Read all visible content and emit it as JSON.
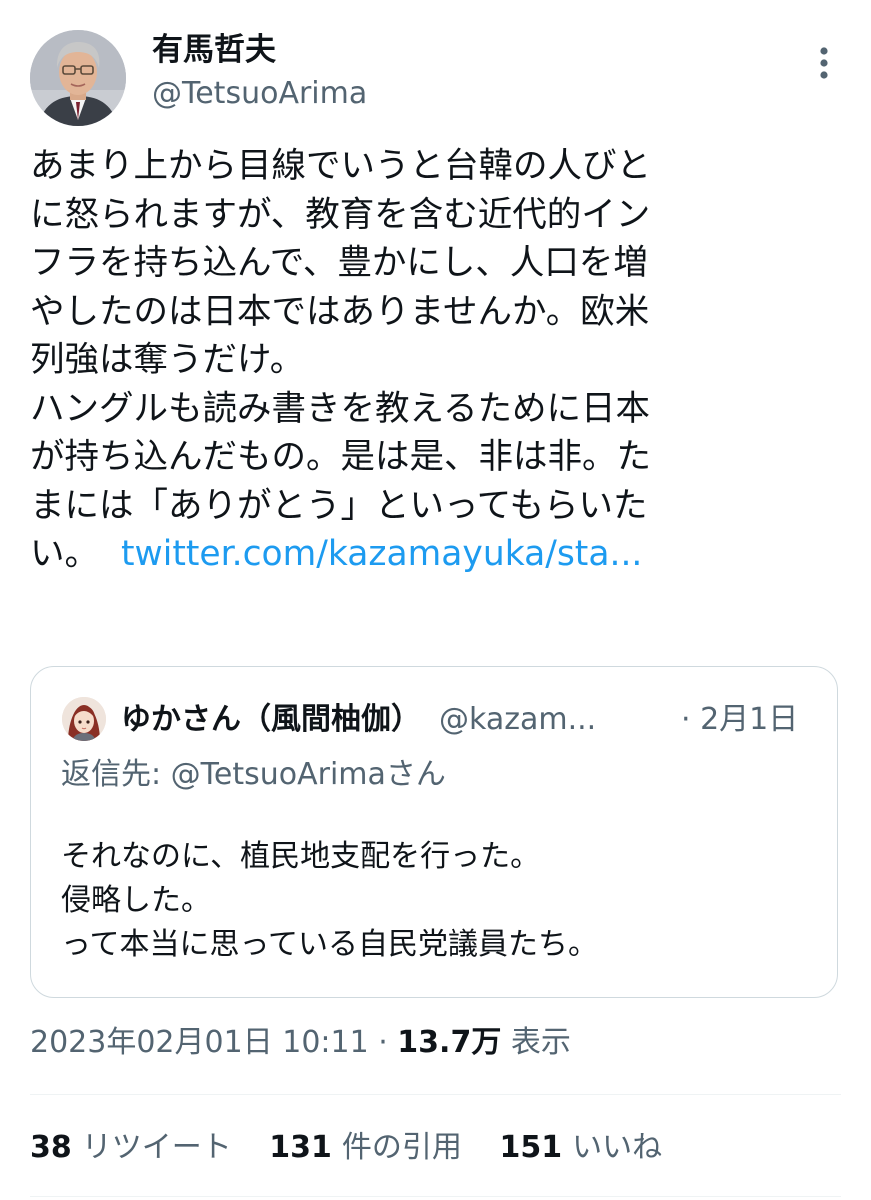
{
  "author": {
    "display_name": "有馬哲夫",
    "handle": "@TetsuoArima",
    "avatar_icon": "profile-photo-icon"
  },
  "tweet": {
    "lines": [
      "あまり上から目線でいうと台韓の人びと",
      "に怒られますが、教育を含む近代的イン",
      "フラを持ち込んで、豊かにし、人口を増",
      "やしたのは日本ではありませんか。欧米",
      "列強は奪うだけ。",
      "ハングルも読み書きを教えるために日本",
      "が持ち込んだもの。是は是、非は非。た",
      "まには「ありがとう」といってもらいた"
    ],
    "last_line_text": "い。",
    "link_text": "twitter.com/kazamayuka/sta..."
  },
  "quote": {
    "display_name": "ゆかさん（風間柚伽）",
    "handle": "@kazam...",
    "date": "· 2月1日",
    "replying_to": "返信先: @TetsuoArimaさん",
    "lines": [
      "それなのに、植民地支配を行った。",
      "侵略した。",
      "って本当に思っている自民党議員たち。"
    ]
  },
  "meta": {
    "timestamp": "2023年02月01日 10:11 · ",
    "views_count": "13.7万",
    "views_label": " 表示"
  },
  "stats": {
    "retweets_count": "38",
    "retweets_label": "リツイート",
    "quotes_count": "131",
    "quotes_label": "件の引用",
    "likes_count": "151",
    "likes_label": "いいね"
  },
  "colors": {
    "link": "#1d9bf0",
    "secondary_text": "#536471",
    "primary_text": "#0f1419",
    "border": "#cfd9de"
  }
}
